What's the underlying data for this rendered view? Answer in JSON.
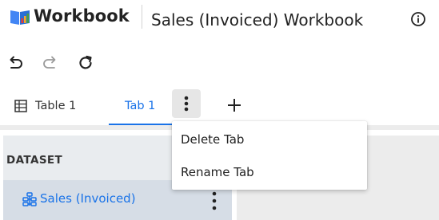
{
  "header": {
    "app_name": "Workbook",
    "document_title": "Sales (Invoiced) Workbook",
    "logo_icon": "workbook-logo-icon",
    "info_icon": "info-icon"
  },
  "toolbar": {
    "undo_icon": "undo-icon",
    "redo_icon": "redo-icon",
    "refresh_icon": "refresh-icon"
  },
  "tabs": [
    {
      "label": "Table 1",
      "icon": "table-icon",
      "active": false
    },
    {
      "label": "Tab 1",
      "active": true
    }
  ],
  "tab_actions": {
    "more_icon": "more-vertical-icon",
    "add_icon": "plus-icon"
  },
  "tab_menu": {
    "items": [
      {
        "label": "Delete Tab"
      },
      {
        "label": "Rename Tab"
      }
    ]
  },
  "panel": {
    "heading": "DATASET",
    "items": [
      {
        "label": "Sales (Invoiced)",
        "icon": "dataset-icon",
        "selected": true
      }
    ]
  },
  "colors": {
    "accent": "#1a73e8",
    "logo_blue": "#4285f4",
    "logo_orange": "#f9a825",
    "logo_red": "#e53935",
    "logo_green": "#43a047",
    "panel_bg": "#e9ecef",
    "selected_row_bg": "#d6dde6"
  }
}
